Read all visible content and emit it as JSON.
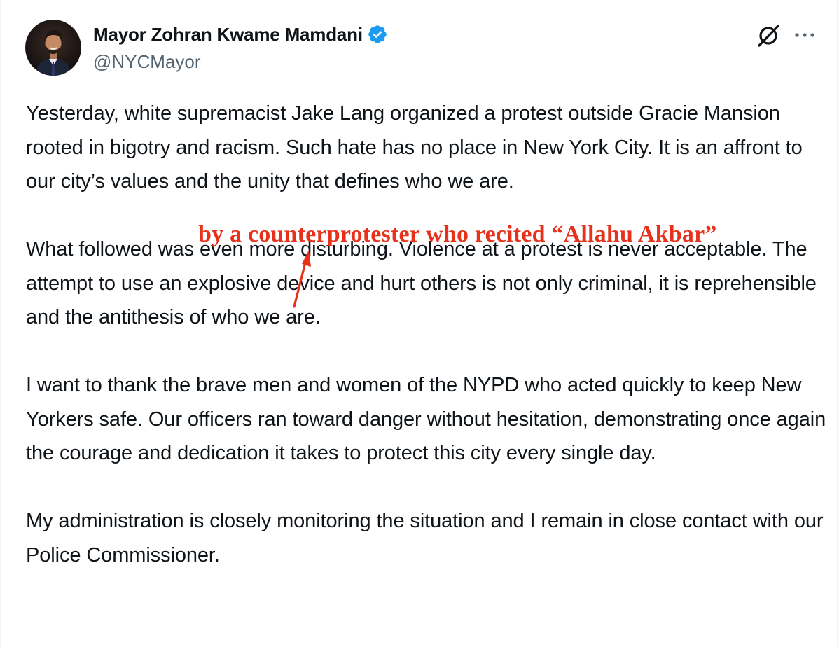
{
  "tweet": {
    "author_name": "Mayor Zohran Kwame Mamdani",
    "handle": "@NYCMayor",
    "verified_color": "#1d9bf0",
    "body": "Yesterday, white supremacist Jake Lang organized a protest outside Gracie Mansion rooted in bigotry and racism. Such hate has no place in New York City. It is an affront to our city’s values and the unity that defines who we are.\n\nWhat followed was even more disturbing. Violence at a protest is never acceptable. The attempt to use an explosive device and hurt others is not only criminal, it is reprehensible and the antithesis of who we are.\n\nI want to thank the brave men and women of the NYPD who acted quickly to keep New Yorkers safe. Our officers ran toward danger without hesitation, demonstrating once again the courage and dedication it takes to protect this city every single day.\n\nMy administration is closely monitoring the situation and I remain in close contact with our Police Commissioner."
  },
  "icons": {
    "avatar": "user-avatar-photo",
    "verified": "verified-badge-icon",
    "grok": "grok-icon",
    "more": "more-options-icon"
  },
  "annotation": {
    "text": "by a counterprotester who recited “Allahu Akbar”",
    "color": "#e8311a"
  }
}
